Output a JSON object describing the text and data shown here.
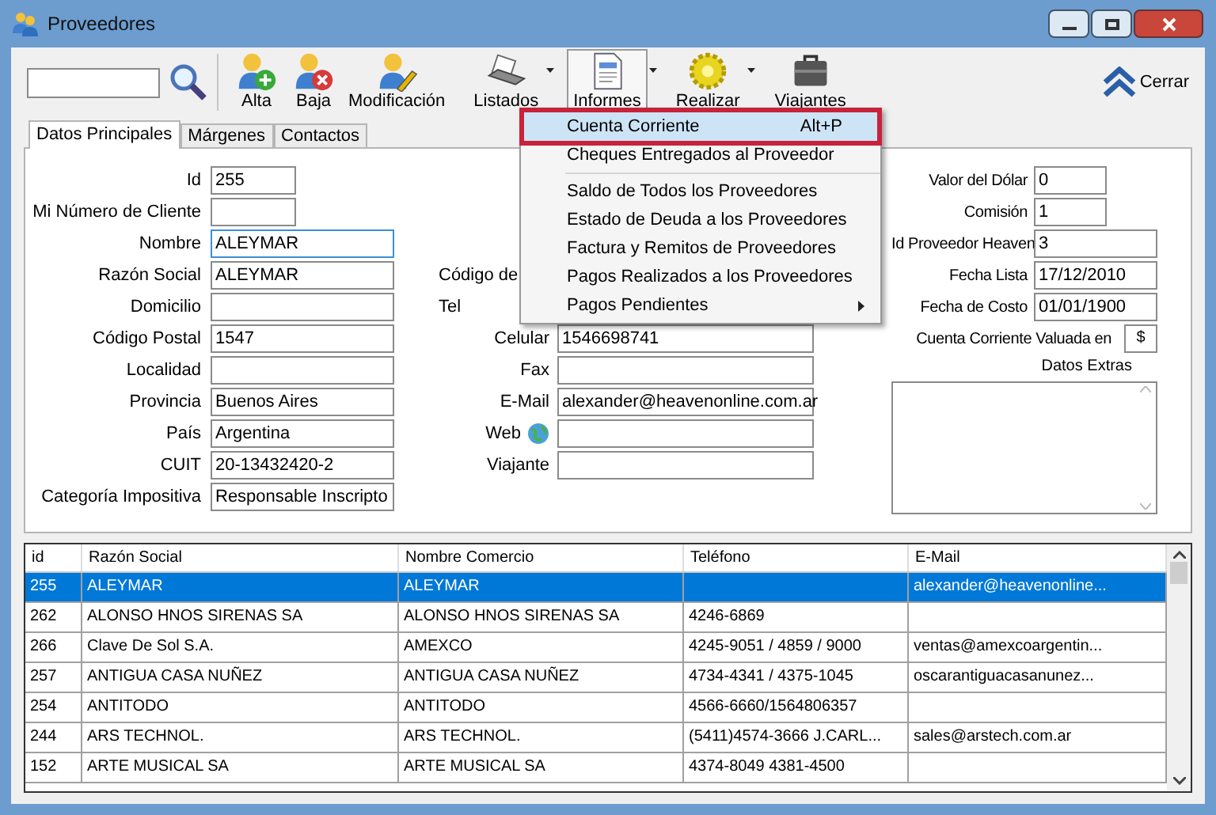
{
  "window": {
    "title": "Proveedores"
  },
  "toolbar": {
    "buttons": [
      {
        "label": "Alta",
        "dropdown": false,
        "pressed": false
      },
      {
        "label": "Baja",
        "dropdown": false,
        "pressed": false
      },
      {
        "label": "Modificación",
        "dropdown": false,
        "pressed": false
      },
      {
        "label": "Listados",
        "dropdown": true,
        "pressed": false
      },
      {
        "label": "Informes",
        "dropdown": true,
        "pressed": true
      },
      {
        "label": "Realizar",
        "dropdown": true,
        "pressed": false
      },
      {
        "label": "Viajantes",
        "dropdown": false,
        "pressed": false
      }
    ],
    "close": {
      "label": "Cerrar"
    }
  },
  "tabs": [
    {
      "label": "Datos Principales",
      "selected": true
    },
    {
      "label": "Márgenes",
      "selected": false
    },
    {
      "label": "Contactos",
      "selected": false
    }
  ],
  "form": {
    "left": [
      {
        "label": "Id",
        "value": "255",
        "focused": false
      },
      {
        "label": "Mi Número de Cliente",
        "focused": false
      },
      {
        "label": "Nombre",
        "value": "ALEYMAR",
        "focused": true
      },
      {
        "label": "Razón Social",
        "value": "ALEYMAR",
        "focused": false
      },
      {
        "label": "Domicilio",
        "focused": false
      },
      {
        "label": "Código Postal",
        "value": "1547",
        "focused": false
      },
      {
        "label": "Localidad",
        "focused": false
      },
      {
        "label": "Provincia",
        "value": "Buenos Aires",
        "focused": false
      },
      {
        "label": "País",
        "value": "Argentina",
        "focused": false
      },
      {
        "label": "CUIT",
        "value": "20-13432420-2",
        "focused": false
      },
      {
        "label": "Categoría Impositiva",
        "value": "Responsable Inscripto",
        "focused": false
      }
    ],
    "middle": [
      {
        "kind": "covered",
        "label": "Código de"
      },
      {
        "kind": "covered",
        "label": "Tel"
      },
      {
        "kind": "field",
        "label": "Celular",
        "value": "1546698741"
      },
      {
        "kind": "field",
        "label": "Fax"
      },
      {
        "kind": "field",
        "label": "E-Mail",
        "value": "alexander@heavenonline.com.ar"
      },
      {
        "kind": "web",
        "label": "Web"
      },
      {
        "kind": "field",
        "label": "Viajante"
      }
    ],
    "right": [
      {
        "label": "Valor del Dólar",
        "value": "0"
      },
      {
        "label": "Comisión",
        "value": "1"
      },
      {
        "label": "Id Proveedor Heaven",
        "value": "3"
      },
      {
        "label": "Fecha Lista",
        "value": "17/12/2010"
      },
      {
        "label": "Fecha de Costo",
        "value": "01/01/1900"
      }
    ],
    "currency": {
      "label": "Cuenta Corriente Valuada en",
      "value": "$"
    },
    "extras": {
      "label": "Datos Extras"
    }
  },
  "menu": {
    "items": [
      {
        "kind": "item",
        "label": "Cuenta Corriente",
        "shortcut": "Alt+P",
        "selected": true,
        "submenu": false
      },
      {
        "kind": "item",
        "label": "Cheques Entregados al Proveedor",
        "selected": false,
        "submenu": false
      },
      {
        "kind": "separator"
      },
      {
        "kind": "item",
        "label": "Saldo de Todos los Proveedores",
        "selected": false,
        "submenu": false
      },
      {
        "kind": "item",
        "label": "Estado de Deuda a los Proveedores",
        "selected": false,
        "submenu": false
      },
      {
        "kind": "item",
        "label": "Factura y Remitos de Proveedores",
        "selected": false,
        "submenu": false
      },
      {
        "kind": "item",
        "label": "Pagos Realizados a los Proveedores",
        "selected": false,
        "submenu": false
      },
      {
        "kind": "item",
        "label": "Pagos Pendientes",
        "selected": false,
        "submenu": true
      }
    ]
  },
  "table": {
    "columns": [
      "id",
      "Razón Social",
      "Nombre Comercio",
      "Teléfono",
      "E-Mail"
    ],
    "rows": [
      {
        "selected": true,
        "cells": [
          "255",
          "ALEYMAR",
          "ALEYMAR",
          null,
          "alexander@heavenonline..."
        ]
      },
      {
        "selected": false,
        "cells": [
          "262",
          "ALONSO HNOS SIRENAS SA",
          "ALONSO HNOS SIRENAS SA",
          "4246-6869",
          null
        ]
      },
      {
        "selected": false,
        "cells": [
          "266",
          "Clave De Sol S.A.",
          "AMEXCO",
          "4245-9051 / 4859 / 9000",
          "ventas@amexcoargentin..."
        ]
      },
      {
        "selected": false,
        "cells": [
          "257",
          "ANTIGUA CASA NUÑEZ",
          "ANTIGUA CASA NUÑEZ",
          "4734-4341 / 4375-1045",
          "oscarantiguacasanunez..."
        ]
      },
      {
        "selected": false,
        "cells": [
          "254",
          "ANTITODO",
          "ANTITODO",
          "4566-6660/1564806357",
          null
        ]
      },
      {
        "selected": false,
        "cells": [
          "244",
          "ARS TECHNOL.",
          "ARS TECHNOL.",
          "(5411)4574-3666 J.CARL...",
          "sales@arstech.com.ar"
        ]
      },
      {
        "selected": false,
        "cells": [
          "152",
          "ARTE MUSICAL SA",
          "ARTE MUSICAL SA",
          "4374-8049  4381-4500",
          null
        ]
      }
    ]
  }
}
